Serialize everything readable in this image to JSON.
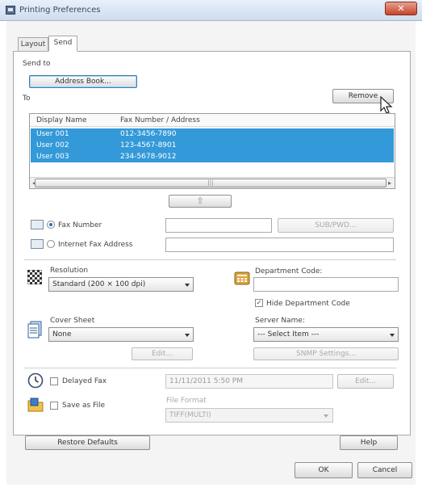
{
  "window": {
    "title": "Printing Preferences",
    "close_label": "✕"
  },
  "tabs": [
    {
      "label": "Layout"
    },
    {
      "label": "Send"
    }
  ],
  "send_to": {
    "group_label": "Send to",
    "address_book_button": "Address Book...",
    "to_label": "To",
    "remove_button": "Remove",
    "columns": [
      "Display Name",
      "Fax Number / Address"
    ],
    "rows": [
      {
        "name": "User 001",
        "number": "012-3456-7890"
      },
      {
        "name": "User 002",
        "number": "123-4567-8901"
      },
      {
        "name": "User 003",
        "number": "234-5678-9012"
      }
    ],
    "scroll_thumb_label": "|||",
    "add_arrow": "⇧"
  },
  "entry": {
    "fax_number_label": "Fax Number",
    "internet_fax_label": "Internet Fax Address",
    "sub_pwd_button": "SUB/PWD..."
  },
  "resolution": {
    "label": "Resolution",
    "value": "Standard (200 × 100 dpi)"
  },
  "department": {
    "label": "Department Code:",
    "hide_label": "Hide Department Code"
  },
  "cover_sheet": {
    "label": "Cover Sheet",
    "value": "None",
    "edit_button": "Edit..."
  },
  "server": {
    "label": "Server Name:",
    "value": "--- Select Item ---",
    "snmp_button": "SNMP Settings..."
  },
  "delayed_fax": {
    "label": "Delayed Fax",
    "datetime": "11/11/2011 5:50 PM",
    "edit_button": "Edit..."
  },
  "save_as_file": {
    "label": "Save as File",
    "format_label": "File Format",
    "format_value": "TIFF(MULTI)"
  },
  "footer": {
    "restore_button": "Restore Defaults",
    "help_button": "Help",
    "ok_button": "OK",
    "cancel_button": "Cancel"
  },
  "colors": {
    "selection": "#3399d8",
    "accent": "#3c7fb1",
    "close": "#c8452b"
  }
}
